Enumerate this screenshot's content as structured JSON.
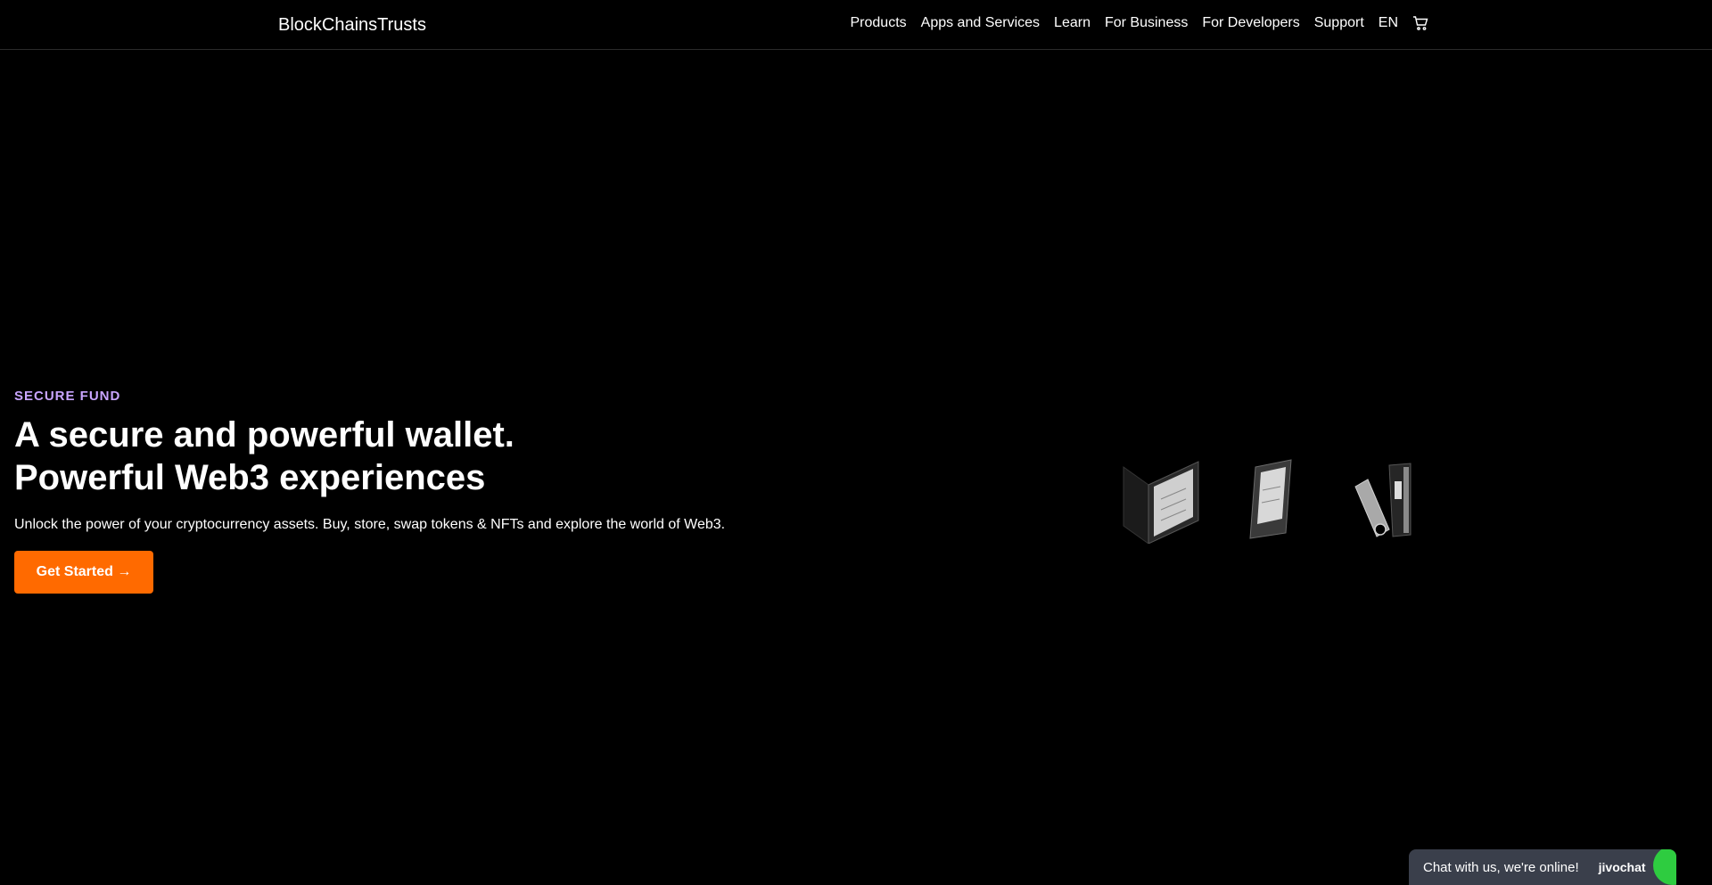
{
  "header": {
    "brand": "BlockChainsTrusts",
    "nav": [
      "Products",
      "Apps and Services",
      "Learn",
      "For Business",
      "For Developers",
      "Support",
      "EN"
    ],
    "cart_icon": "cart-icon"
  },
  "hero": {
    "eyebrow": "SECURE FUND",
    "headline_line1": "A secure and powerful wallet.",
    "headline_line2": "Powerful Web3 experiences",
    "subtext": "Unlock the power of your cryptocurrency assets. Buy, store, swap tokens & NFTs and explore the world of Web3.",
    "cta_label": "Get Started →"
  },
  "chat": {
    "text": "Chat with us, we're online!",
    "brand": "jivochat"
  },
  "colors": {
    "background": "#000000",
    "accent": "#ff6a00",
    "eyebrow": "#c9a5ff",
    "chat_bg": "#3a3f4b",
    "chat_badge": "#2ecc40"
  }
}
